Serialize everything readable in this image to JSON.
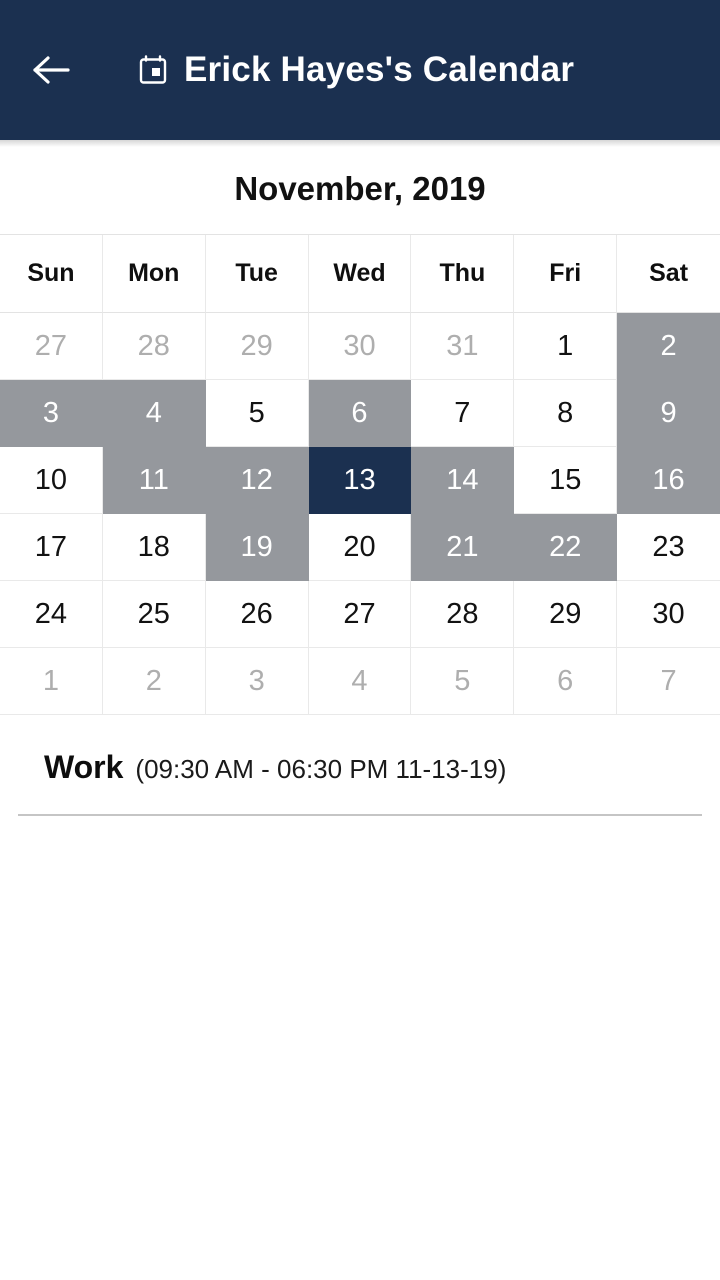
{
  "appbar": {
    "back_icon": "back-arrow-icon",
    "calendar_icon": "calendar-icon",
    "title": "Erick Hayes's Calendar",
    "background_color": "#1b3050"
  },
  "calendar": {
    "month_title": "November, 2019",
    "weekdays": [
      "Sun",
      "Mon",
      "Tue",
      "Wed",
      "Thu",
      "Fri",
      "Sat"
    ],
    "colors": {
      "busy": "#95989d",
      "selected": "#1b3050",
      "muted_text": "#aeaeae",
      "grid_line": "#e9e9e9"
    },
    "weeks": [
      [
        {
          "day": "27",
          "state": "muted"
        },
        {
          "day": "28",
          "state": "muted"
        },
        {
          "day": "29",
          "state": "muted"
        },
        {
          "day": "30",
          "state": "muted"
        },
        {
          "day": "31",
          "state": "muted"
        },
        {
          "day": "1",
          "state": "normal"
        },
        {
          "day": "2",
          "state": "busy"
        }
      ],
      [
        {
          "day": "3",
          "state": "busy"
        },
        {
          "day": "4",
          "state": "busy"
        },
        {
          "day": "5",
          "state": "normal"
        },
        {
          "day": "6",
          "state": "busy"
        },
        {
          "day": "7",
          "state": "normal"
        },
        {
          "day": "8",
          "state": "normal"
        },
        {
          "day": "9",
          "state": "busy"
        }
      ],
      [
        {
          "day": "10",
          "state": "normal"
        },
        {
          "day": "11",
          "state": "busy"
        },
        {
          "day": "12",
          "state": "busy"
        },
        {
          "day": "13",
          "state": "selected"
        },
        {
          "day": "14",
          "state": "busy"
        },
        {
          "day": "15",
          "state": "normal"
        },
        {
          "day": "16",
          "state": "busy"
        }
      ],
      [
        {
          "day": "17",
          "state": "normal"
        },
        {
          "day": "18",
          "state": "normal"
        },
        {
          "day": "19",
          "state": "busy"
        },
        {
          "day": "20",
          "state": "normal"
        },
        {
          "day": "21",
          "state": "busy"
        },
        {
          "day": "22",
          "state": "busy"
        },
        {
          "day": "23",
          "state": "normal"
        }
      ],
      [
        {
          "day": "24",
          "state": "normal"
        },
        {
          "day": "25",
          "state": "normal"
        },
        {
          "day": "26",
          "state": "normal"
        },
        {
          "day": "27",
          "state": "normal"
        },
        {
          "day": "28",
          "state": "normal"
        },
        {
          "day": "29",
          "state": "normal"
        },
        {
          "day": "30",
          "state": "normal"
        }
      ],
      [
        {
          "day": "1",
          "state": "muted"
        },
        {
          "day": "2",
          "state": "muted"
        },
        {
          "day": "3",
          "state": "muted"
        },
        {
          "day": "4",
          "state": "muted"
        },
        {
          "day": "5",
          "state": "muted"
        },
        {
          "day": "6",
          "state": "muted"
        },
        {
          "day": "7",
          "state": "muted"
        }
      ]
    ]
  },
  "events": [
    {
      "title": "Work",
      "meta": "(09:30 AM - 06:30 PM 11-13-19)"
    }
  ]
}
